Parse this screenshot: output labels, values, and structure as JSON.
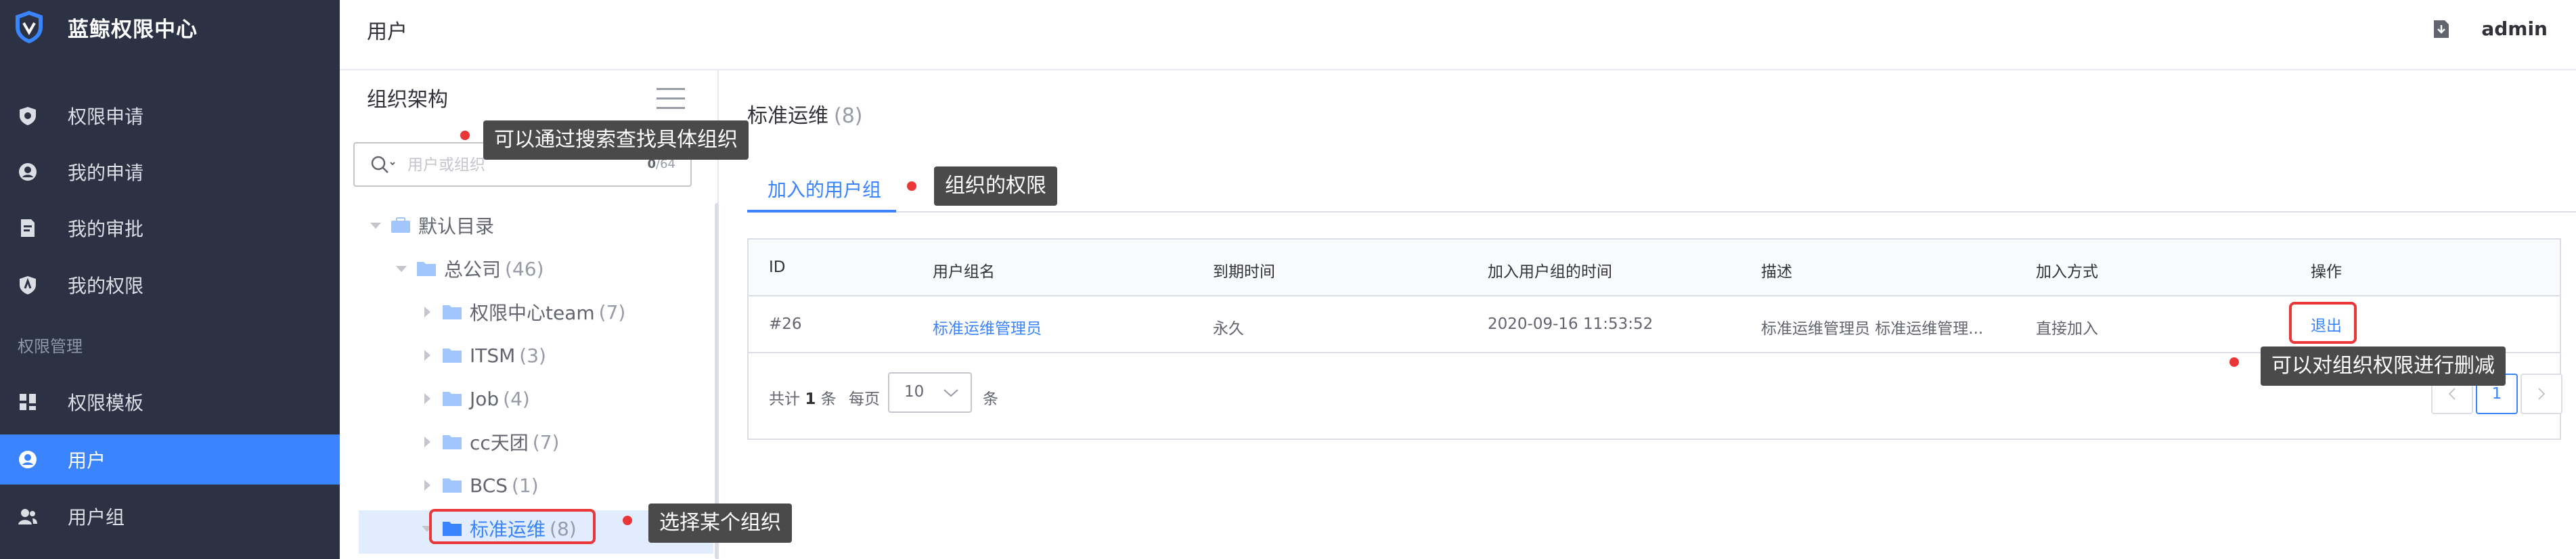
{
  "app": {
    "title": "蓝鲸权限中心"
  },
  "sidebar": {
    "items": [
      {
        "label": "权限申请",
        "icon": "permission-apply-icon"
      },
      {
        "label": "我的申请",
        "icon": "my-apply-icon"
      },
      {
        "label": "我的审批",
        "icon": "my-approval-icon"
      },
      {
        "label": "我的权限",
        "icon": "my-permission-icon"
      }
    ],
    "group_label": "权限管理",
    "manage_items": [
      {
        "label": "权限模板",
        "icon": "template-icon"
      },
      {
        "label": "用户",
        "icon": "user-icon",
        "active": true
      },
      {
        "label": "用户组",
        "icon": "user-group-icon"
      }
    ]
  },
  "header": {
    "title": "用户",
    "user": "admin"
  },
  "tree": {
    "title": "组织架构",
    "search_placeholder": "用户或组织",
    "search_count_current": "0",
    "search_count_max": "/64",
    "nodes": [
      {
        "label": "默认目录",
        "count": "",
        "level": 0,
        "expanded": true,
        "type": "directory"
      },
      {
        "label": "总公司",
        "count": "(46)",
        "level": 1,
        "expanded": true,
        "type": "folder"
      },
      {
        "label": "权限中心team",
        "count": "(7)",
        "level": 2,
        "expanded": false,
        "type": "folder"
      },
      {
        "label": "ITSM",
        "count": "(3)",
        "level": 2,
        "expanded": false,
        "type": "folder"
      },
      {
        "label": "Job",
        "count": "(4)",
        "level": 2,
        "expanded": false,
        "type": "folder"
      },
      {
        "label": "cc天团",
        "count": "(7)",
        "level": 2,
        "expanded": false,
        "type": "folder"
      },
      {
        "label": "BCS",
        "count": "(1)",
        "level": 2,
        "expanded": false,
        "type": "folder"
      },
      {
        "label": "标准运维",
        "count": "(8)",
        "level": 2,
        "expanded": false,
        "type": "folder",
        "selected": true
      }
    ]
  },
  "detail": {
    "title": "标准运维",
    "count": "(8)",
    "tabs": [
      {
        "label": "加入的用户组",
        "active": true
      }
    ],
    "table": {
      "columns": [
        "ID",
        "用户组名",
        "到期时间",
        "加入用户组的时间",
        "描述",
        "加入方式",
        "操作"
      ],
      "rows": [
        {
          "id": "#26",
          "group_name": "标准运维管理员",
          "expire": "永久",
          "joined_at": "2020-09-16 11:53:52",
          "description": "标准运维管理员 标准运维管理...",
          "join_type": "直接加入",
          "action": "退出"
        }
      ]
    },
    "pagination": {
      "total_prefix": "共计",
      "total": "1",
      "total_suffix": "条",
      "per_page_label": "每页",
      "per_page": "10",
      "per_page_unit": "条",
      "current_page": "1",
      "prev_icon": "chevron-left-icon",
      "next_icon": "chevron-right-icon"
    }
  },
  "annotations": {
    "search_tip": "可以通过搜索查找具体组织",
    "tab_tip": "组织的权限",
    "action_tip": "可以对组织权限进行删减",
    "select_tip": "选择某个组织"
  },
  "colors": {
    "accent": "#3a84ff",
    "sidebar_bg": "#2c3244",
    "annotation_red": "#ea3636",
    "tooltip_bg": "#4a4a4a"
  }
}
